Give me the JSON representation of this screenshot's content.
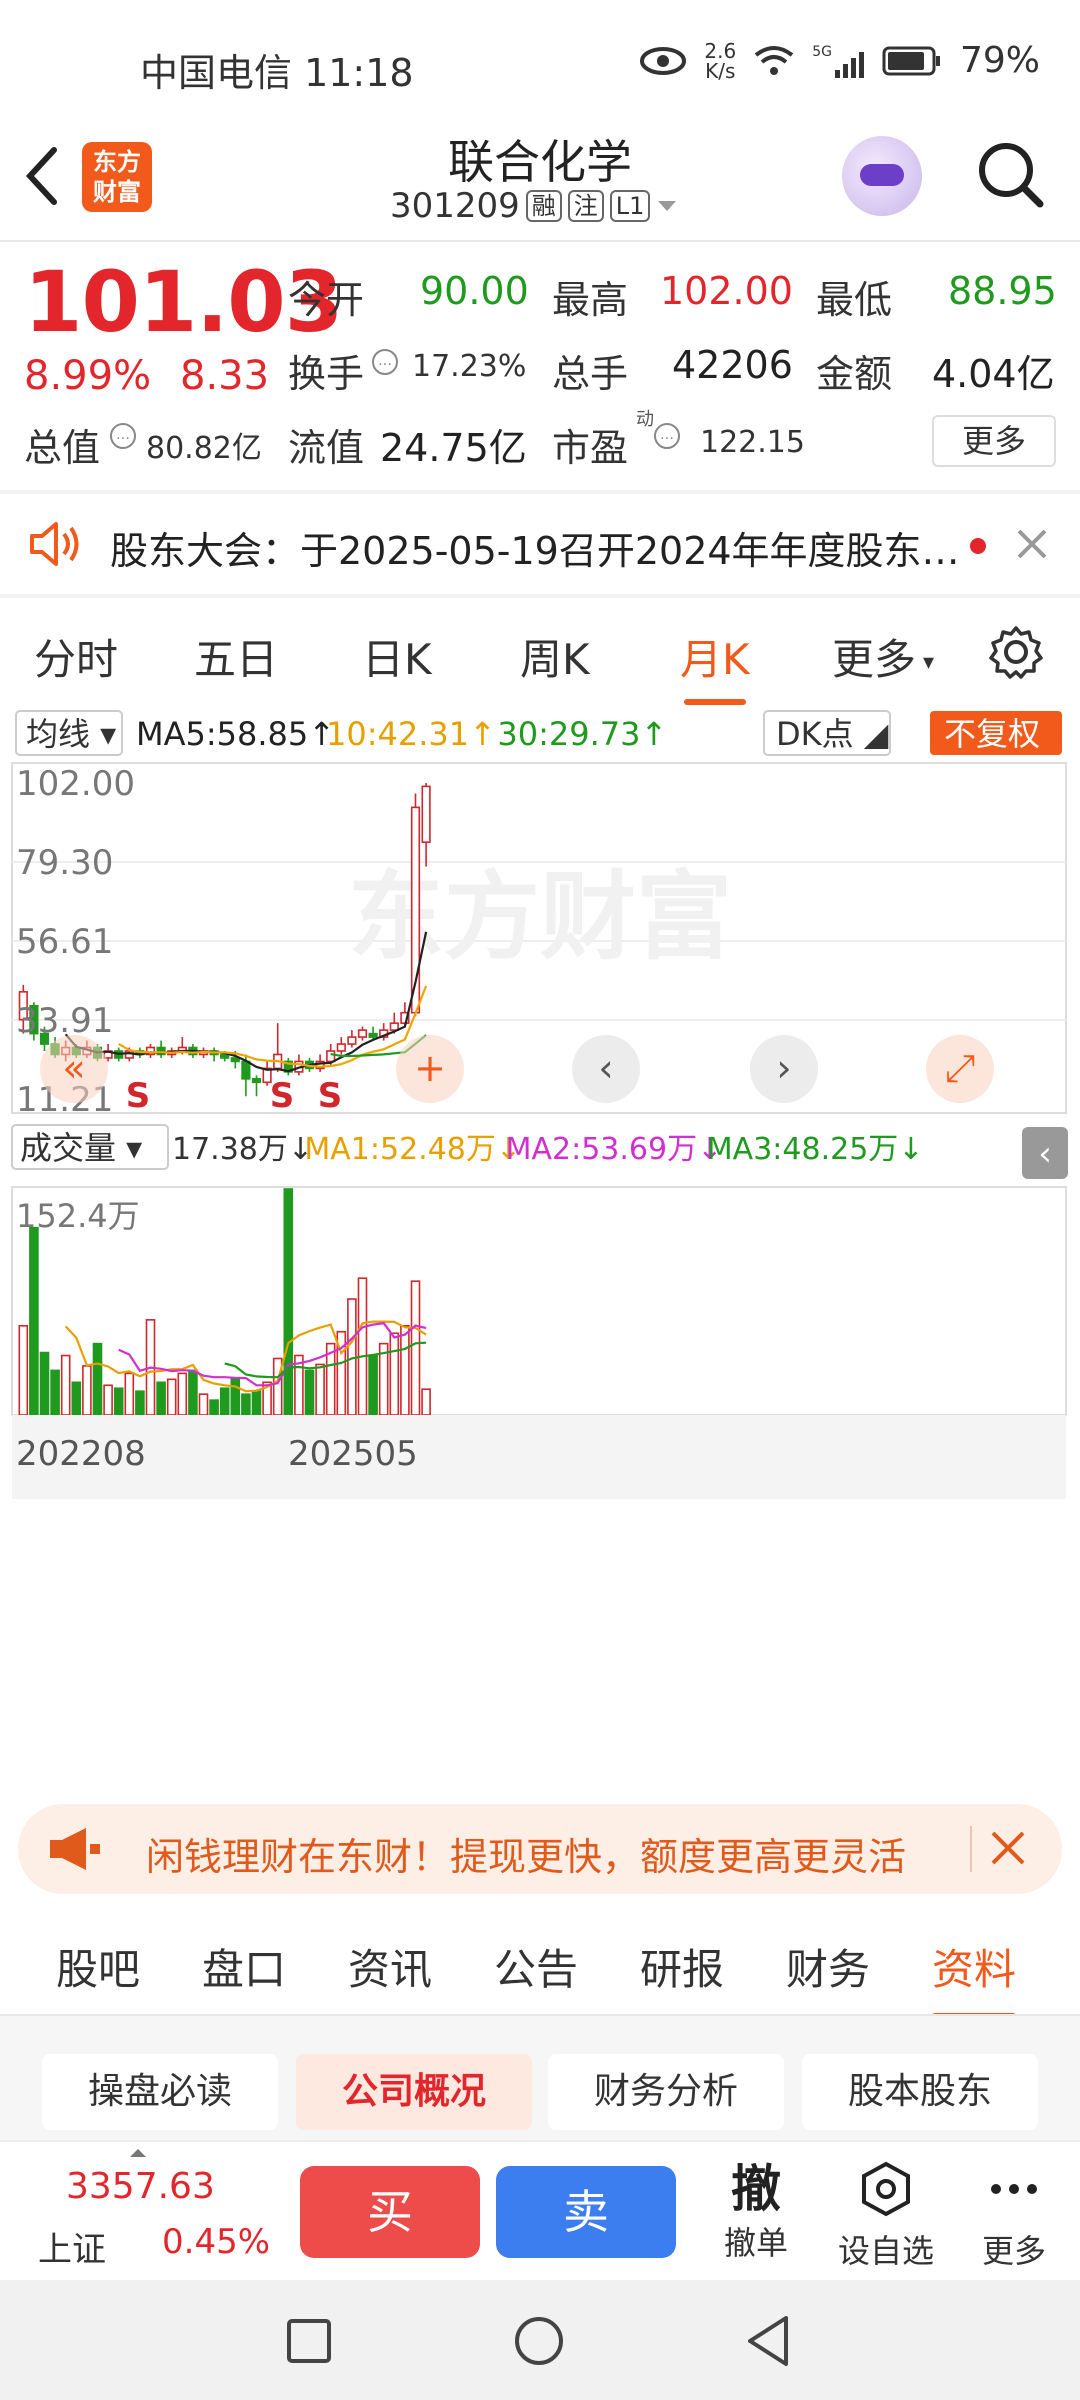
{
  "status_bar": {
    "carrier_time": "中国电信 11:18",
    "net_speed_value": "2.6",
    "net_speed_unit": "K/s",
    "signal": "5G",
    "battery": "79%"
  },
  "header": {
    "logo_line1": "东方",
    "logo_line2": "财富",
    "stock_name": "联合化学",
    "stock_code": "301209",
    "tag_margin": "融",
    "tag_register": "注",
    "tag_level": "L1"
  },
  "quote": {
    "price": "101.03",
    "change_pct": "8.99%",
    "change_amt": "8.33",
    "open_label": "今开",
    "open": "90.00",
    "high_label": "最高",
    "high": "102.00",
    "low_label": "最低",
    "low": "88.95",
    "turnover_label": "换手",
    "turnover": "17.23%",
    "volume_label": "总手",
    "volume": "42206",
    "amount_label": "金额",
    "amount": "4.04亿",
    "mktcap_label": "总值",
    "mktcap": "80.82亿",
    "float_label": "流值",
    "float_cap": "24.75亿",
    "pe_label": "市盈",
    "pe_sup": "动",
    "pe": "122.15",
    "more_label": "更多"
  },
  "notice": {
    "text": "股东大会：于2025-05-19召开2024年年度股东…"
  },
  "period_tabs": [
    "分时",
    "五日",
    "日K",
    "周K",
    "月K",
    "更多"
  ],
  "chart_data": {
    "type": "candlestick",
    "period": "月K",
    "ma_selector": "均线",
    "ma5": "MA5:58.85",
    "ma10": "10:42.31",
    "ma30": "30:29.73",
    "dk_label": "DK点",
    "adj_label": "不复权",
    "price_ticks": [
      "102.00",
      "79.30",
      "56.61",
      "33.91",
      "11.21"
    ],
    "ylim": [
      11.21,
      102.0
    ],
    "signal_marks": [
      "S",
      "S",
      "S"
    ],
    "volume_selector": "成交量",
    "volume_value": "17.38万",
    "vol_ma1": "MA1:52.48万",
    "vol_ma2": "MA2:53.69万",
    "vol_ma3": "MA3:48.25万",
    "volume_max_tick": "152.4万",
    "x_ticks": [
      "202208",
      "202505"
    ],
    "colors": {
      "up": "#d0262c",
      "down": "#1f9a1f",
      "ma5": "#222222",
      "ma10": "#f0a500",
      "ma30": "#1f9a1f",
      "vma2": "#d22fd2"
    },
    "candles": [
      {
        "o": 34,
        "c": 42,
        "h": 44,
        "l": 30
      },
      {
        "o": 38,
        "c": 30,
        "h": 39,
        "l": 28
      },
      {
        "o": 30,
        "c": 27,
        "h": 32,
        "l": 25
      },
      {
        "o": 27,
        "c": 24,
        "h": 29,
        "l": 23
      },
      {
        "o": 24,
        "c": 26,
        "h": 28,
        "l": 22
      },
      {
        "o": 26,
        "c": 24,
        "h": 27,
        "l": 23
      },
      {
        "o": 24,
        "c": 26,
        "h": 28,
        "l": 23
      },
      {
        "o": 26,
        "c": 23,
        "h": 27,
        "l": 22
      },
      {
        "o": 23,
        "c": 25,
        "h": 27,
        "l": 22
      },
      {
        "o": 25,
        "c": 23,
        "h": 26,
        "l": 22
      },
      {
        "o": 23,
        "c": 25,
        "h": 26,
        "l": 22
      },
      {
        "o": 25,
        "c": 24,
        "h": 26,
        "l": 23
      },
      {
        "o": 24,
        "c": 26,
        "h": 27,
        "l": 23
      },
      {
        "o": 26,
        "c": 24,
        "h": 28,
        "l": 23
      },
      {
        "o": 24,
        "c": 25,
        "h": 26,
        "l": 23
      },
      {
        "o": 25,
        "c": 26,
        "h": 29,
        "l": 24
      },
      {
        "o": 26,
        "c": 24,
        "h": 27,
        "l": 23
      },
      {
        "o": 24,
        "c": 25,
        "h": 26,
        "l": 23
      },
      {
        "o": 25,
        "c": 24,
        "h": 26,
        "l": 22
      },
      {
        "o": 24,
        "c": 23,
        "h": 25,
        "l": 22
      },
      {
        "o": 23,
        "c": 22,
        "h": 25,
        "l": 20
      },
      {
        "o": 22,
        "c": 17,
        "h": 24,
        "l": 12
      },
      {
        "o": 17,
        "c": 16,
        "h": 18,
        "l": 12
      },
      {
        "o": 16,
        "c": 20,
        "h": 22,
        "l": 15
      },
      {
        "o": 20,
        "c": 24,
        "h": 33,
        "l": 19
      },
      {
        "o": 22,
        "c": 19,
        "h": 23,
        "l": 18
      },
      {
        "o": 19,
        "c": 22,
        "h": 24,
        "l": 18
      },
      {
        "o": 22,
        "c": 20,
        "h": 23,
        "l": 19
      },
      {
        "o": 20,
        "c": 22,
        "h": 24,
        "l": 19
      },
      {
        "o": 22,
        "c": 25,
        "h": 27,
        "l": 21
      },
      {
        "o": 25,
        "c": 27,
        "h": 29,
        "l": 24
      },
      {
        "o": 27,
        "c": 29,
        "h": 31,
        "l": 26
      },
      {
        "o": 29,
        "c": 31,
        "h": 32,
        "l": 28
      },
      {
        "o": 30,
        "c": 29,
        "h": 32,
        "l": 28
      },
      {
        "o": 29,
        "c": 31,
        "h": 33,
        "l": 28
      },
      {
        "o": 31,
        "c": 33,
        "h": 36,
        "l": 30
      },
      {
        "o": 33,
        "c": 36,
        "h": 39,
        "l": 32
      },
      {
        "o": 36,
        "c": 95,
        "h": 99,
        "l": 35
      },
      {
        "o": 85,
        "c": 101.03,
        "h": 102,
        "l": 78
      }
    ],
    "volumes_wan": [
      60,
      126,
      42,
      30,
      40,
      22,
      33,
      48,
      20,
      18,
      28,
      16,
      64,
      22,
      24,
      28,
      30,
      14,
      10,
      18,
      24,
      14,
      16,
      22,
      38,
      152,
      40,
      30,
      34,
      48,
      56,
      78,
      92,
      40,
      48,
      55,
      60,
      90,
      17.38
    ]
  },
  "ad": {
    "text": "闲钱理财在东财！提现更快，额度更高更灵活"
  },
  "info_tabs": [
    "股吧",
    "盘口",
    "资讯",
    "公告",
    "研报",
    "财务",
    "资料"
  ],
  "sub_tabs": [
    "操盘必读",
    "公司概况",
    "财务分析",
    "股本股东"
  ],
  "trade": {
    "index_value": "3357.63",
    "index_name": "上证",
    "index_change": "0.45%",
    "buy": "买",
    "sell": "卖",
    "cancel_icon_text": "撤",
    "cancel_label": "撤单",
    "watch_label": "设自选",
    "more_label": "更多"
  }
}
